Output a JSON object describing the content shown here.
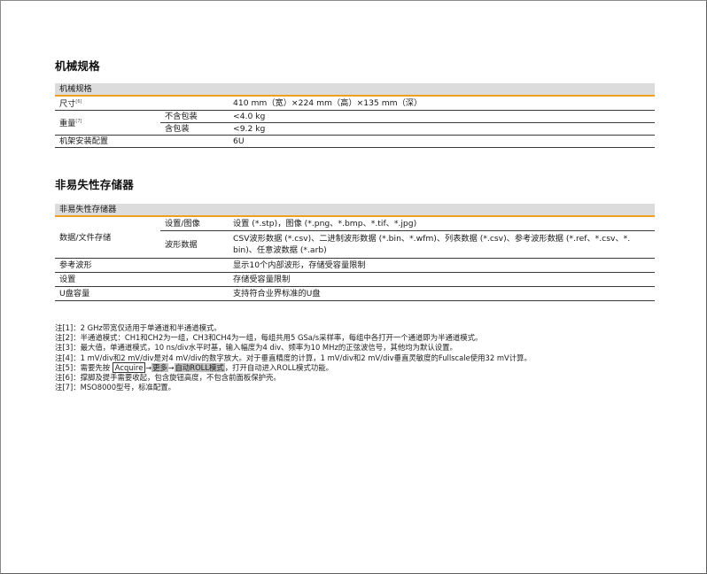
{
  "mech": {
    "title": "机械规格",
    "table_head": "机械规格",
    "size_label": "尺寸",
    "size_note": "[6]",
    "size_value": "410 mm（宽）×224 mm（高）×135 mm（深）",
    "weight_label": "重量",
    "weight_note": "[7]",
    "weight_no_pkg_label": "不含包装",
    "weight_no_pkg_value": "<4.0 kg",
    "weight_pkg_label": "含包装",
    "weight_pkg_value": "<9.2 kg",
    "rack_label": "机架安装配置",
    "rack_value": "6U"
  },
  "storage": {
    "title": "非易失性存储器",
    "table_head": "非易失性存储器",
    "data_file_label": "数据/文件存储",
    "setup_image_label": "设置/图像",
    "setup_image_value": "设置 (*.stp)，图像 (*.png、*.bmp、*.tif、*.jpg)",
    "waveform_data_label": "波形数据",
    "waveform_data_value_1": "CSV波形数据 (*.csv)、二进制波形数据 (*.bin、*.wfm)、列表数据 (*.csv)、参考波形数据 (*.ref、*.csv、*.",
    "waveform_data_value_2": "bin)、任意波数据 (*.arb)",
    "ref_wave_label": "参考波形",
    "ref_wave_value": "显示10个内部波形，存储受容量限制",
    "setup_label": "设置",
    "setup_value": "存储受容量限制",
    "usb_label": "U盘容量",
    "usb_value": "支持符合业界标准的U盘"
  },
  "notes": {
    "n1": "注[1]：2 GHz带宽仅适用于单通道和半通道模式。",
    "n2": "注[2]：半通道模式：CH1和CH2为一组，CH3和CH4为一组，每组共用5 GSa/s采样率，每组中各打开一个通道即为半通道模式。",
    "n3": "注[3]：最大值，单通道模式，10 ns/div水平时基，输入幅度为4 div、频率为10 MHz的正弦波信号，其他均为默认设置。",
    "n4": "注[4]：1 mV/div和2 mV/div是对4 mV/div的数字放大。对于垂直精度的计算，1 mV/div和2 mV/div垂直灵敏度的Fullscale使用32 mV计算。",
    "n5_prefix": "注[5]：需要先按",
    "n5_key": "Acquire",
    "n5_arrow1": "→",
    "n5_more": "更多",
    "n5_arrow2": "→",
    "n5_roll": "自动ROLL模式",
    "n5_suffix": "，打开自动进入ROLL模式功能。",
    "n6": "注[6]：撑脚及提手需要收起，包含旋钮高度，不包含前面板保护壳。",
    "n7": "注[7]：MSO8000型号，标准配置。"
  }
}
